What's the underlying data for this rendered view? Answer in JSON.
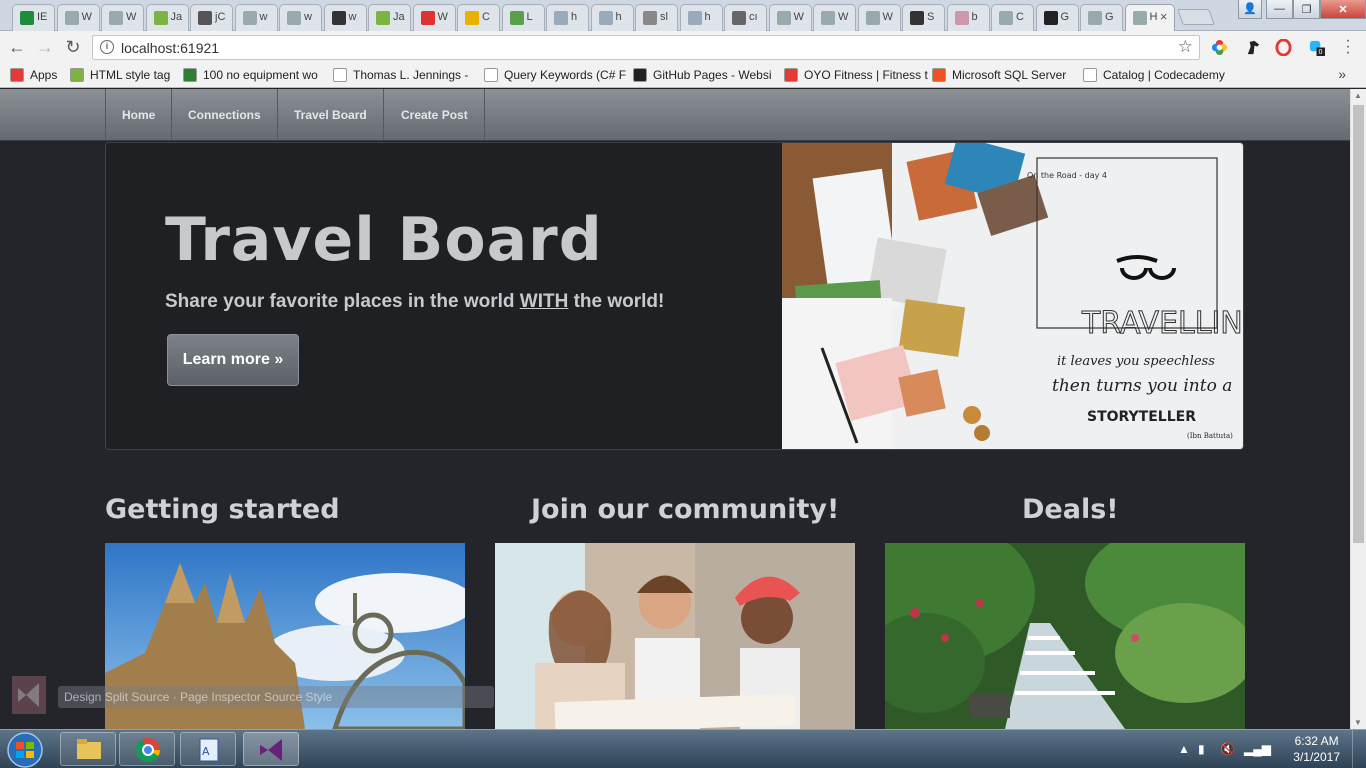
{
  "browser": {
    "tabs": [
      {
        "label": "IE",
        "color": "#1e8c3a"
      },
      {
        "label": "W",
        "color": "#9aa"
      },
      {
        "label": "W",
        "color": "#9aa"
      },
      {
        "label": "Ja",
        "color": "#7cb342"
      },
      {
        "label": "jC",
        "color": "#555"
      },
      {
        "label": "w",
        "color": "#9aa"
      },
      {
        "label": "w",
        "color": "#9aa"
      },
      {
        "label": "w",
        "color": "#333"
      },
      {
        "label": "Ja",
        "color": "#7cb342"
      },
      {
        "label": "W",
        "color": "#d33"
      },
      {
        "label": "C",
        "color": "#e5b300"
      },
      {
        "label": "L",
        "color": "#5aa04a"
      },
      {
        "label": "h",
        "color": "#9ab"
      },
      {
        "label": "h",
        "color": "#9ab"
      },
      {
        "label": "sl",
        "color": "#888"
      },
      {
        "label": "h",
        "color": "#9ab"
      },
      {
        "label": "cı",
        "color": "#666"
      },
      {
        "label": "W",
        "color": "#9aa"
      },
      {
        "label": "W",
        "color": "#9aa"
      },
      {
        "label": "W",
        "color": "#9aa"
      },
      {
        "label": "S",
        "color": "#333"
      },
      {
        "label": "b",
        "color": "#c9a"
      },
      {
        "label": "C",
        "color": "#9aa"
      },
      {
        "label": "G",
        "color": "#222"
      },
      {
        "label": "G",
        "color": "#9aa"
      },
      {
        "label": "H",
        "color": "#9aa"
      }
    ],
    "active_tab_close": "×",
    "url": "localhost:61921",
    "bookmarks": [
      {
        "label": "Apps",
        "color": "#e53935"
      },
      {
        "label": "HTML style tag",
        "color": "#7cb342"
      },
      {
        "label": "100 no equipment wo",
        "color": "#2e7d32"
      },
      {
        "label": "Thomas L. Jennings -",
        "color": "#ffffff"
      },
      {
        "label": "Query Keywords (C# F",
        "color": "#ffffff"
      },
      {
        "label": "GitHub Pages - Websi",
        "color": "#222222"
      },
      {
        "label": "OYO Fitness | Fitness t",
        "color": "#e53935"
      },
      {
        "label": "Microsoft SQL Server",
        "color": "#f25022"
      },
      {
        "label": "Catalog | Codecademy",
        "color": "#ffffff"
      }
    ],
    "bookmarks_more": "»"
  },
  "site": {
    "nav": [
      "Home",
      "Connections",
      "Travel Board",
      "Create Post"
    ],
    "hero": {
      "title": "Travel Board",
      "lead_before": "Share your favorite places in the world ",
      "lead_emph": "WITH",
      "lead_after": " the world!",
      "button": "Learn more »"
    },
    "art": {
      "heading": "TRAVELLING",
      "line1": "it leaves you speechless",
      "line2": "then turns you into a",
      "line3": "STORYTELLER",
      "top_note": "On the Road - day 4",
      "signature": "(Ibn Battuta)"
    },
    "columns": [
      {
        "heading": "Getting started"
      },
      {
        "heading": "Join our community!"
      },
      {
        "heading": "Deals!"
      }
    ]
  },
  "overlay": {
    "text": "Design   Split   Source   ·   Page Inspector   Source Style"
  },
  "taskbar": {
    "time": "6:32 AM",
    "date": "3/1/2017"
  }
}
